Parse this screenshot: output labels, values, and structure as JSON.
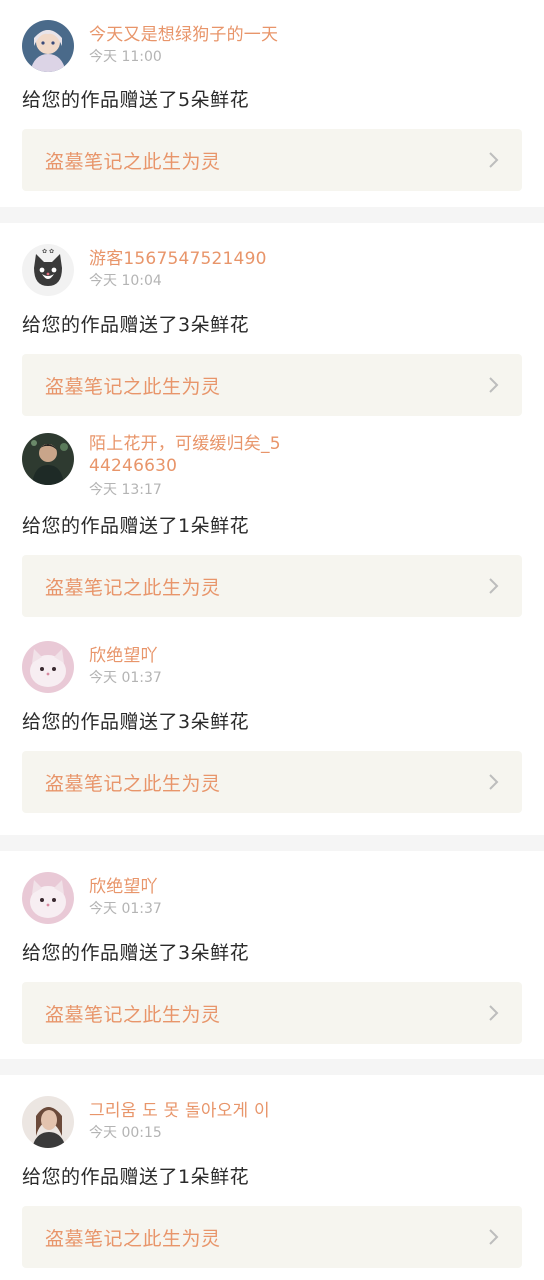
{
  "items": [
    {
      "username": "今天又是想绿狗子的一天",
      "time": "今天 11:00",
      "message": "给您的作品赠送了5朵鲜花",
      "work_title": "盗墓笔记之此生为灵",
      "avatar": "illustrated-girl-avatar"
    },
    {
      "username": "游客1567547521490",
      "time": "今天 10:04",
      "message": "给您的作品赠送了3朵鲜花",
      "work_title": "盗墓笔记之此生为灵",
      "avatar": "cat-avatar"
    },
    {
      "username": "陌上花开，可缓缓归矣_544246630",
      "time": "今天 13:17",
      "message": "给您的作品赠送了1朵鲜花",
      "work_title": "盗墓笔记之此生为灵",
      "avatar": "person-photo-avatar"
    },
    {
      "username": "欣绝望吖",
      "time": "今天 01:37",
      "message": "给您的作品赠送了3朵鲜花",
      "work_title": "盗墓笔记之此生为灵",
      "avatar": "pink-cat-avatar"
    },
    {
      "username": "欣绝望吖",
      "time": "今天 01:37",
      "message": "给您的作品赠送了3朵鲜花",
      "work_title": "盗墓笔记之此生为灵",
      "avatar": "pink-cat-avatar"
    },
    {
      "username": "그리움 도 못 돌아오게 이",
      "time": "今天 00:15",
      "message": "给您的作品赠送了1朵鲜花",
      "work_title": "盗墓笔记之此生为灵",
      "avatar": "portrait-avatar"
    }
  ],
  "colors": {
    "accent": "#e8956a",
    "card_bg": "#f6f5ef",
    "separator": "#f5f5f5",
    "time": "#b4b4b4"
  }
}
